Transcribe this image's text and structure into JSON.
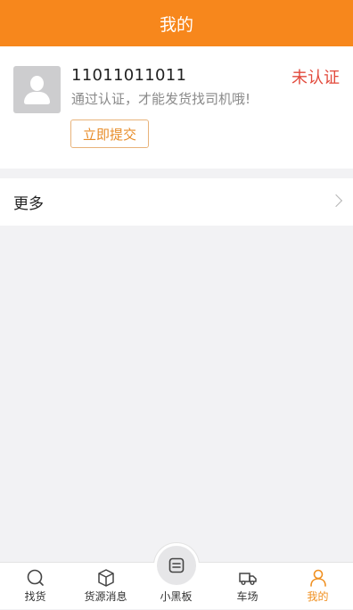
{
  "header": {
    "title": "我的"
  },
  "profile": {
    "phone": "11011011011",
    "status": "未认证",
    "hint": "通过认证，才能发货找司机哦!",
    "submit_label": "立即提交"
  },
  "menu": {
    "more_label": "更多"
  },
  "tabbar": {
    "items": [
      {
        "label": "找货",
        "icon": "search-icon"
      },
      {
        "label": "货源消息",
        "icon": "box-icon"
      },
      {
        "label": "小黑板",
        "icon": "board-icon"
      },
      {
        "label": "车场",
        "icon": "truck-icon"
      },
      {
        "label": "我的",
        "icon": "person-icon",
        "active": true
      }
    ]
  },
  "colors": {
    "header": "#f7871c",
    "status": "#e24a3c",
    "accent": "#f09020"
  }
}
